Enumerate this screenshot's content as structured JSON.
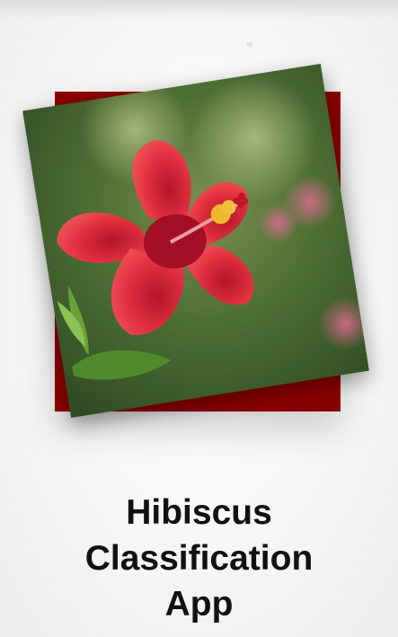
{
  "app": {
    "title_lines": [
      "Hibiscus",
      "Classification",
      "App"
    ]
  },
  "hero": {
    "image_icon": "hibiscus-flower-photo",
    "frame_color": "#8b0000"
  }
}
